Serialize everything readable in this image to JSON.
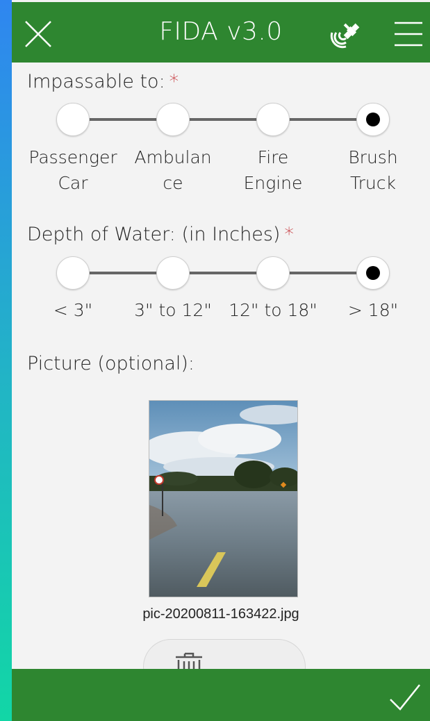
{
  "header": {
    "title": "FIDA v3.0",
    "close_icon": "close-icon",
    "gps_icon": "satellite-gps-icon",
    "menu_icon": "hamburger-menu-icon"
  },
  "impassable": {
    "label": "Impassable to:",
    "required_mark": "*",
    "options": [
      "Passenger\nCar",
      "Ambulan\nce",
      "Fire\nEngine",
      "Brush\nTruck"
    ],
    "selected": "Brush Truck"
  },
  "depth": {
    "label": "Depth of Water: (in Inches)",
    "required_mark": "*",
    "options": [
      "< 3\"",
      "3\" to 12\"",
      "12\" to 18\"",
      "> 18\""
    ],
    "selected": "> 18\""
  },
  "picture": {
    "label": "Picture (optional):",
    "filename": "pic-20200811-163422.jpg",
    "delete_icon": "trash-icon"
  },
  "footer": {
    "submit_icon": "checkmark-icon"
  },
  "colors": {
    "bar_green": "#2e8630",
    "required_red": "#c1272d",
    "background": "#f3f3f3"
  }
}
